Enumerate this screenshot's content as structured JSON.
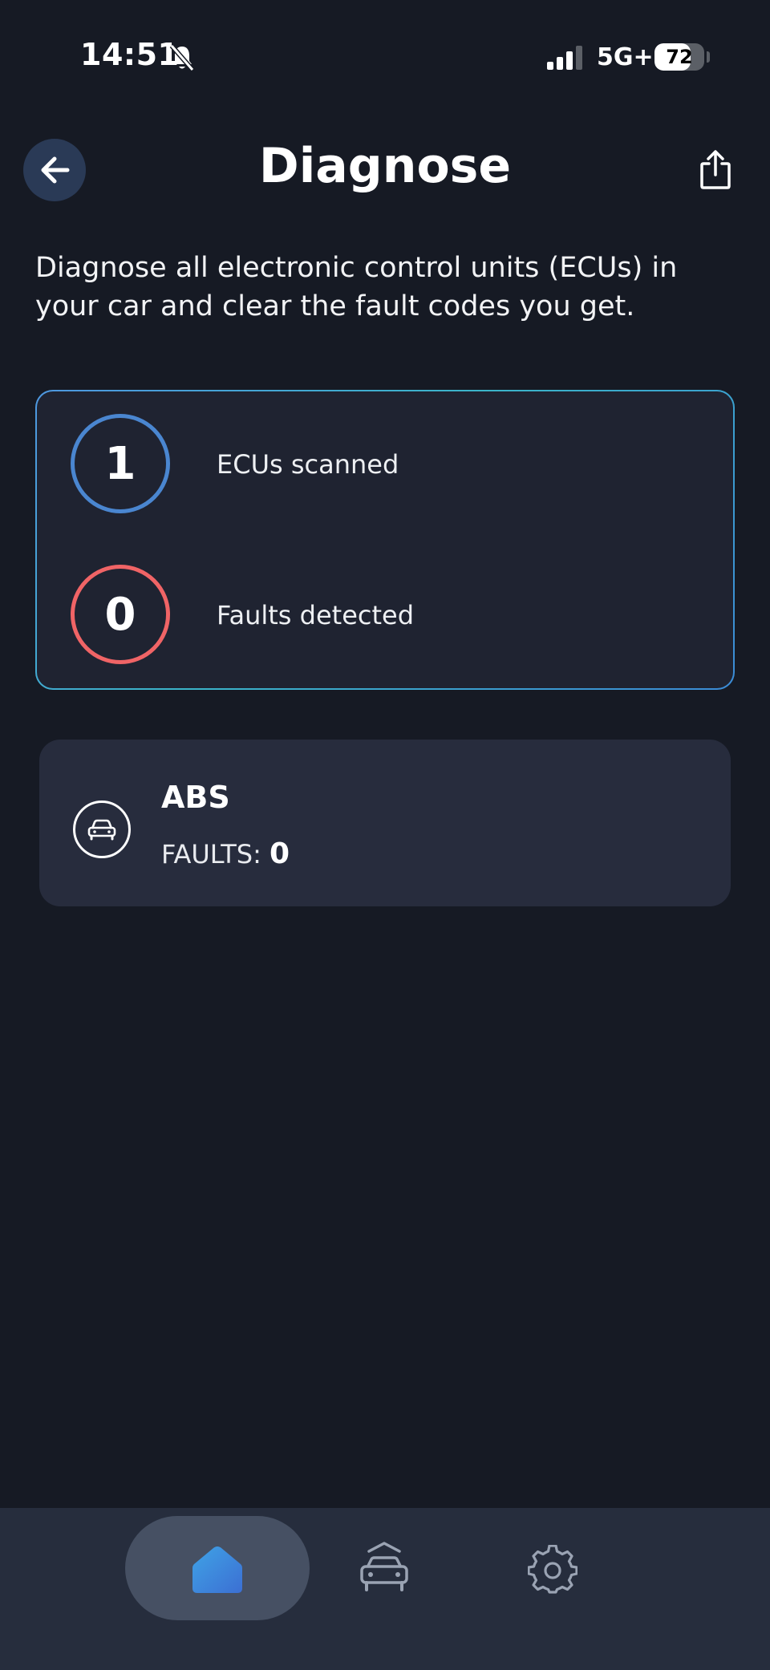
{
  "status_bar": {
    "time": "14:51",
    "network": "5G+",
    "battery": "72",
    "battery_level": 0.72
  },
  "header": {
    "title": "Diagnose",
    "back_icon": "arrow-left-icon",
    "share_icon": "share-icon"
  },
  "description": "Diagnose all electronic control units (ECUs) in your car and clear the fault codes you get.",
  "summary": {
    "ecus_scanned_value": "1",
    "ecus_scanned_label": "ECUs scanned",
    "faults_detected_value": "0",
    "faults_detected_label": "Faults detected"
  },
  "ecus": [
    {
      "name": "ABS",
      "faults_label": "FAULTS:",
      "faults_value": "0",
      "icon": "car-icon"
    }
  ],
  "bottom_nav": {
    "items": [
      {
        "icon": "home-icon",
        "active": true
      },
      {
        "icon": "car-lift-icon",
        "active": false
      },
      {
        "icon": "gear-icon",
        "active": false
      }
    ]
  },
  "colors": {
    "background": "#161a24",
    "card": "#1f2331",
    "ecu_card": "#272c3d",
    "accent_blue": "#4a86d0",
    "accent_red": "#f06466",
    "nav_bar": "#262d3d",
    "nav_active_pill": "#465063"
  }
}
